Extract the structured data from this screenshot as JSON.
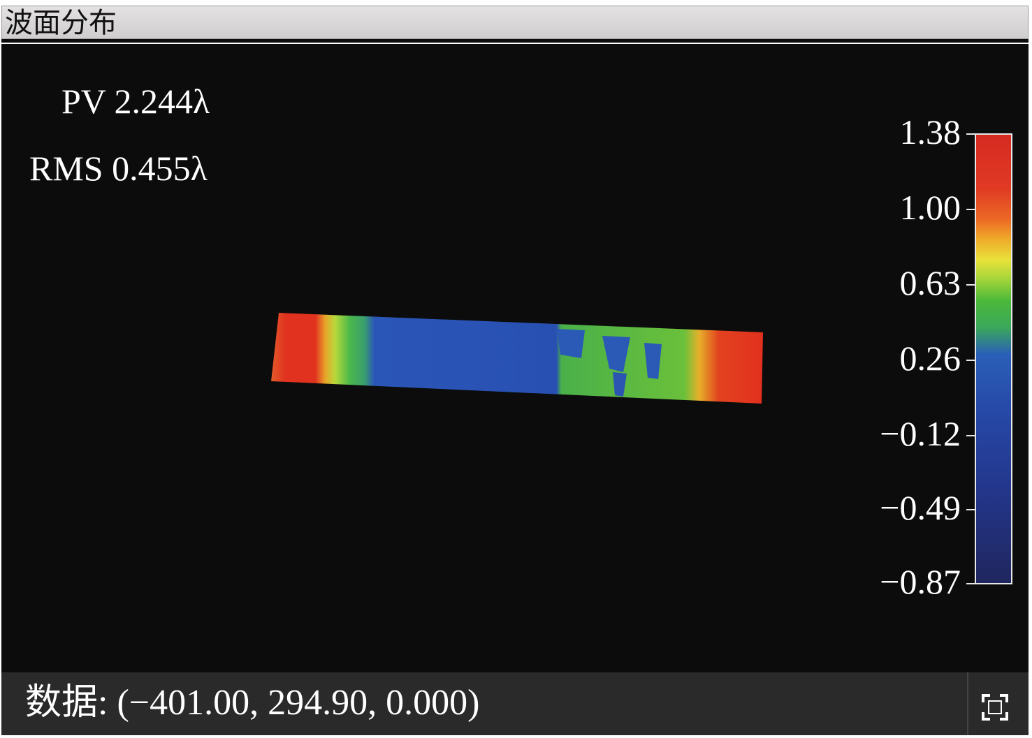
{
  "window": {
    "title": "波面分布"
  },
  "stats": {
    "pv": "PV 2.244λ",
    "rms": "RMS 0.455λ"
  },
  "colorbar": {
    "ticks": [
      "1.38",
      "1.00",
      "0.63",
      "0.26",
      "−0.12",
      "−0.49",
      "−0.87"
    ]
  },
  "statusbar": {
    "data_readout": "数据: (−401.00, 294.90, 0.000)",
    "expand_icon": "fullscreen-icon"
  }
}
